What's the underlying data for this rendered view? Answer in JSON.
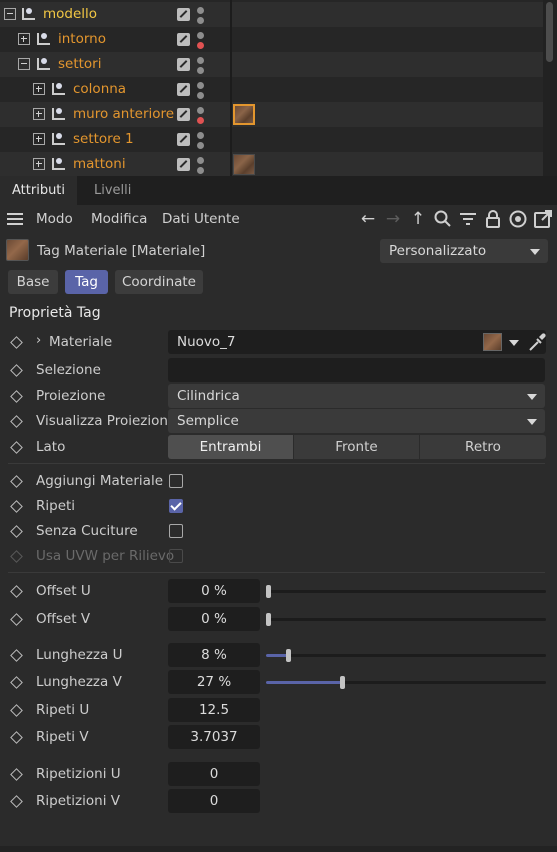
{
  "tree": {
    "rows": [
      {
        "name": "modello",
        "expanded": true,
        "highlight": "yellow",
        "dot_red": false,
        "thumb": false,
        "thumb_selected": false
      },
      {
        "name": "intorno",
        "expanded": false,
        "highlight": "orange",
        "dot_red": true,
        "thumb": false,
        "thumb_selected": false
      },
      {
        "name": "settori",
        "expanded": true,
        "highlight": "orange",
        "dot_red": false,
        "thumb": false,
        "thumb_selected": false
      },
      {
        "name": "colonna",
        "expanded": false,
        "highlight": "orange",
        "dot_red": false,
        "thumb": false,
        "thumb_selected": false
      },
      {
        "name": "muro anteriore",
        "expanded": false,
        "highlight": "orange",
        "dot_red": true,
        "thumb": true,
        "thumb_selected": true
      },
      {
        "name": "settore 1",
        "expanded": false,
        "highlight": "orange",
        "dot_red": false,
        "thumb": false,
        "thumb_selected": false
      },
      {
        "name": "mattoni",
        "expanded": false,
        "highlight": "orange",
        "dot_red": false,
        "thumb": true,
        "thumb_selected": false
      }
    ]
  },
  "tabs": {
    "attributi": "Attributi",
    "livelli": "Livelli",
    "active": "attributi"
  },
  "menu": {
    "modo": "Modo",
    "modifica": "Modifica",
    "dati_utente": "Dati Utente"
  },
  "header": {
    "title": "Tag Materiale [Materiale]",
    "preset": "Personalizzato"
  },
  "mode_buttons": {
    "base": "Base",
    "tag": "Tag",
    "coordinate": "Coordinate",
    "active": "tag"
  },
  "section_title": "Proprietà Tag",
  "props": {
    "materiale": {
      "label": "Materiale",
      "value": "Nuovo_7"
    },
    "selezione": {
      "label": "Selezione",
      "value": ""
    },
    "proiezione": {
      "label": "Proiezione",
      "value": "Cilindrica"
    },
    "visualizza_proiezione": {
      "label": "Visualizza Proiezione",
      "value": "Semplice"
    },
    "lato": {
      "label": "Lato",
      "options": [
        "Entrambi",
        "Fronte",
        "Retro"
      ],
      "selected": "Entrambi"
    },
    "aggiungi_materiale": {
      "label": "Aggiungi Materiale",
      "checked": false
    },
    "ripeti": {
      "label": "Ripeti",
      "checked": true
    },
    "senza_cuciture": {
      "label": "Senza Cuciture",
      "checked": false
    },
    "usa_uvw": {
      "label": "Usa UVW per Rilievo",
      "checked": false,
      "disabled": true
    },
    "offset_u": {
      "label": "Offset U",
      "value": "0 %",
      "fraction": 0.0
    },
    "offset_v": {
      "label": "Offset V",
      "value": "0 %",
      "fraction": 0.0
    },
    "lunghezza_u": {
      "label": "Lunghezza U",
      "value": "8 %",
      "fraction": 0.08
    },
    "lunghezza_v": {
      "label": "Lunghezza V",
      "value": "27 %",
      "fraction": 0.27
    },
    "ripeti_u": {
      "label": "Ripeti U",
      "value": "12.5"
    },
    "ripeti_v": {
      "label": "Ripeti V",
      "value": "3.7037"
    },
    "ripetizioni_u": {
      "label": "Ripetizioni U",
      "value": "0"
    },
    "ripetizioni_v": {
      "label": "Ripetizioni V",
      "value": "0"
    }
  },
  "colors": {
    "accent": "#5a64a8",
    "object_orange": "#e3962e",
    "object_yellow": "#f2c744",
    "status_red": "#e05252"
  }
}
